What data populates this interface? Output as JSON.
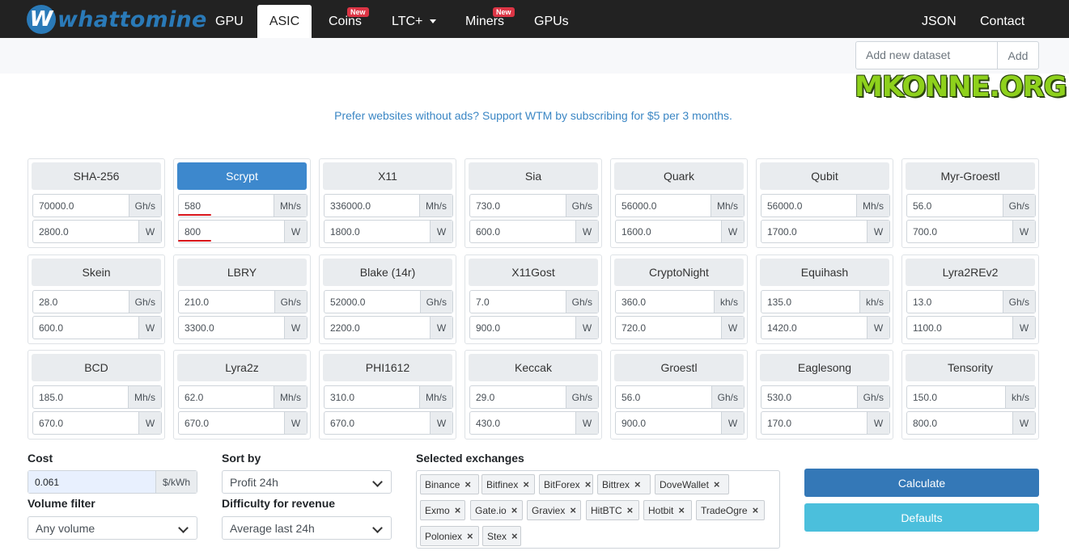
{
  "navbar": {
    "brand": "whattomine",
    "brand_letter": "W",
    "items": [
      {
        "label": "GPU"
      },
      {
        "label": "ASIC"
      },
      {
        "label": "Coins",
        "badge": "New"
      },
      {
        "label": "LTC+"
      },
      {
        "label": "Miners",
        "badge": "New"
      },
      {
        "label": "GPUs"
      },
      {
        "label": "JSON"
      },
      {
        "label": "Contact"
      }
    ],
    "active": "ASIC"
  },
  "dataset": {
    "placeholder": "Add new dataset",
    "add_label": "Add"
  },
  "watermark": "MKONNE.ORG",
  "promo": "Prefer websites without ads? Support WTM by subscribing for $5 per 3 months.",
  "algorithms": [
    {
      "name": "SHA-256",
      "hashrate": "70000.0",
      "unit": "Gh/s",
      "power": "2800.0",
      "power_unit": "W"
    },
    {
      "name": "Scrypt",
      "hashrate": "580",
      "unit": "Mh/s",
      "power": "800",
      "power_unit": "W",
      "active": true
    },
    {
      "name": "X11",
      "hashrate": "336000.0",
      "unit": "Mh/s",
      "power": "1800.0",
      "power_unit": "W"
    },
    {
      "name": "Sia",
      "hashrate": "730.0",
      "unit": "Gh/s",
      "power": "600.0",
      "power_unit": "W"
    },
    {
      "name": "Quark",
      "hashrate": "56000.0",
      "unit": "Mh/s",
      "power": "1600.0",
      "power_unit": "W"
    },
    {
      "name": "Qubit",
      "hashrate": "56000.0",
      "unit": "Mh/s",
      "power": "1700.0",
      "power_unit": "W"
    },
    {
      "name": "Myr-Groestl",
      "hashrate": "56.0",
      "unit": "Gh/s",
      "power": "700.0",
      "power_unit": "W"
    },
    {
      "name": "Skein",
      "hashrate": "28.0",
      "unit": "Gh/s",
      "power": "600.0",
      "power_unit": "W"
    },
    {
      "name": "LBRY",
      "hashrate": "210.0",
      "unit": "Gh/s",
      "power": "3300.0",
      "power_unit": "W"
    },
    {
      "name": "Blake (14r)",
      "hashrate": "52000.0",
      "unit": "Gh/s",
      "power": "2200.0",
      "power_unit": "W"
    },
    {
      "name": "X11Gost",
      "hashrate": "7.0",
      "unit": "Gh/s",
      "power": "900.0",
      "power_unit": "W"
    },
    {
      "name": "CryptoNight",
      "hashrate": "360.0",
      "unit": "kh/s",
      "power": "720.0",
      "power_unit": "W"
    },
    {
      "name": "Equihash",
      "hashrate": "135.0",
      "unit": "kh/s",
      "power": "1420.0",
      "power_unit": "W"
    },
    {
      "name": "Lyra2REv2",
      "hashrate": "13.0",
      "unit": "Gh/s",
      "power": "1100.0",
      "power_unit": "W"
    },
    {
      "name": "BCD",
      "hashrate": "185.0",
      "unit": "Mh/s",
      "power": "670.0",
      "power_unit": "W"
    },
    {
      "name": "Lyra2z",
      "hashrate": "62.0",
      "unit": "Mh/s",
      "power": "670.0",
      "power_unit": "W"
    },
    {
      "name": "PHI1612",
      "hashrate": "310.0",
      "unit": "Mh/s",
      "power": "670.0",
      "power_unit": "W"
    },
    {
      "name": "Keccak",
      "hashrate": "29.0",
      "unit": "Gh/s",
      "power": "430.0",
      "power_unit": "W"
    },
    {
      "name": "Groestl",
      "hashrate": "56.0",
      "unit": "Gh/s",
      "power": "900.0",
      "power_unit": "W"
    },
    {
      "name": "Eaglesong",
      "hashrate": "530.0",
      "unit": "Gh/s",
      "power": "170.0",
      "power_unit": "W"
    },
    {
      "name": "Tensority",
      "hashrate": "150.0",
      "unit": "kh/s",
      "power": "800.0",
      "power_unit": "W"
    }
  ],
  "cost": {
    "label": "Cost",
    "value": "0.061",
    "unit": "$/kWh"
  },
  "volume_filter": {
    "label": "Volume filter",
    "value": "Any volume"
  },
  "sort_by": {
    "label": "Sort by",
    "value": "Profit 24h"
  },
  "difficulty": {
    "label": "Difficulty for revenue",
    "value": "Average last 24h"
  },
  "exchanges": {
    "label": "Selected exchanges",
    "items": [
      "Binance",
      "Bitfinex",
      "BitForex",
      "Bittrex",
      "DoveWallet",
      "Exmo",
      "Gate.io",
      "Graviex",
      "HitBTC",
      "Hotbit",
      "TradeOgre",
      "Poloniex",
      "Stex"
    ],
    "remove_glyph": "×"
  },
  "buttons": {
    "calculate": "Calculate",
    "defaults": "Defaults"
  },
  "colors": {
    "navbar": "#222222",
    "active_algo": "#3d88cd",
    "calculate": "#3478b7",
    "defaults": "#4bbfdc",
    "annotation": "#d9151b"
  }
}
